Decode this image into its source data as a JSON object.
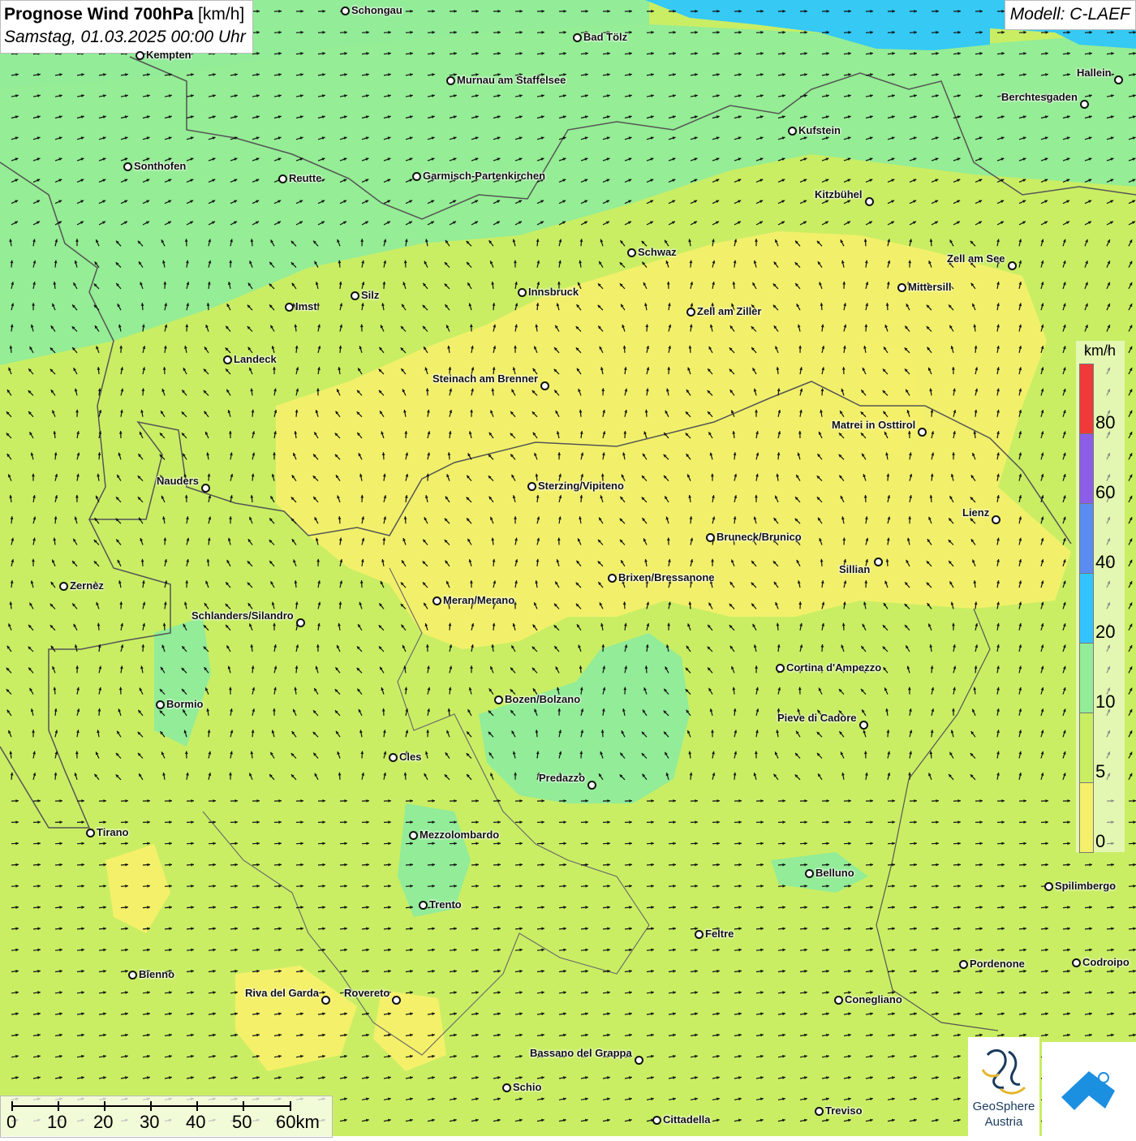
{
  "title": {
    "main": "Prognose Wind 700hPa",
    "unit": "[km/h]",
    "datetime": "Samstag, 01.03.2025 00:00 Uhr"
  },
  "model": "Modell: C-LAEF",
  "colors": {
    "speed_0_5": "#f5f06a",
    "speed_5_10": "#c9ee64",
    "speed_10_20": "#92ec98",
    "speed_20_40": "#33c4ff",
    "speed_40_60": "#5b8cf2",
    "speed_60_80": "#8c5ee8",
    "speed_80_plus": "#f03a3a",
    "border": "#555555"
  },
  "legend": {
    "unit": "km/h",
    "labels": [
      "80",
      "60",
      "40",
      "20",
      "10",
      "5",
      "0"
    ]
  },
  "scale_bar": {
    "labels": [
      "0",
      "10",
      "20",
      "30",
      "40",
      "50",
      "60km"
    ]
  },
  "logos": {
    "geosphere_line1": "GeoSphere",
    "geosphere_line2": "Austria"
  },
  "cities": [
    {
      "id": "schongau",
      "name": "Schongau"
    },
    {
      "id": "bad-toelz",
      "name": "Bad Tölz"
    },
    {
      "id": "kempten",
      "name": "Kempten"
    },
    {
      "id": "murnau",
      "name": "Murnau am Staffelsee"
    },
    {
      "id": "hallein",
      "name": "Hallein"
    },
    {
      "id": "berchtesgaden",
      "name": "Berchtesgaden"
    },
    {
      "id": "kufstein",
      "name": "Kufstein"
    },
    {
      "id": "sonthofen",
      "name": "Sonthofen"
    },
    {
      "id": "reutte",
      "name": "Reutte"
    },
    {
      "id": "garmisch",
      "name": "Garmisch-Partenkirchen"
    },
    {
      "id": "kitzbuehel",
      "name": "Kitzbühel"
    },
    {
      "id": "schwaz",
      "name": "Schwaz"
    },
    {
      "id": "zell-am-see",
      "name": "Zell am See"
    },
    {
      "id": "mittersill",
      "name": "Mittersill"
    },
    {
      "id": "imst",
      "name": "Imst"
    },
    {
      "id": "silz",
      "name": "Silz"
    },
    {
      "id": "innsbruck",
      "name": "Innsbruck"
    },
    {
      "id": "zell-am-ziller",
      "name": "Zell am Ziller"
    },
    {
      "id": "landeck",
      "name": "Landeck"
    },
    {
      "id": "steinach",
      "name": "Steinach am Brenner"
    },
    {
      "id": "matrei",
      "name": "Matrei in Osttirol"
    },
    {
      "id": "nauders",
      "name": "Nauders"
    },
    {
      "id": "sterzing",
      "name": "Sterzing/Vipiteno"
    },
    {
      "id": "lienz",
      "name": "Lienz"
    },
    {
      "id": "bruneck",
      "name": "Bruneck/Brunico"
    },
    {
      "id": "sillian",
      "name": "Sillian"
    },
    {
      "id": "zernez",
      "name": "Zernez"
    },
    {
      "id": "brixen",
      "name": "Brixen/Bressanone"
    },
    {
      "id": "meran",
      "name": "Meran/Merano"
    },
    {
      "id": "schlanders",
      "name": "Schlanders/Silandro"
    },
    {
      "id": "cortina",
      "name": "Cortina d'Ampezzo"
    },
    {
      "id": "bozen",
      "name": "Bozen/Bolzano"
    },
    {
      "id": "bormio",
      "name": "Bormio"
    },
    {
      "id": "pieve",
      "name": "Pieve di Cadore"
    },
    {
      "id": "cles",
      "name": "Cles"
    },
    {
      "id": "predazzo",
      "name": "Predazzo"
    },
    {
      "id": "tirano",
      "name": "Tirano"
    },
    {
      "id": "mezzolombardo",
      "name": "Mezzolombardo"
    },
    {
      "id": "belluno",
      "name": "Belluno"
    },
    {
      "id": "spilimbergo",
      "name": "Spilimbergo"
    },
    {
      "id": "trento",
      "name": "Trento"
    },
    {
      "id": "feltre",
      "name": "Feltre"
    },
    {
      "id": "pordenone",
      "name": "Pordenone"
    },
    {
      "id": "codroipo",
      "name": "Codroipo"
    },
    {
      "id": "bienno",
      "name": "Bienno"
    },
    {
      "id": "riva",
      "name": "Riva del Garda"
    },
    {
      "id": "rovereto",
      "name": "Rovereto"
    },
    {
      "id": "conegliano",
      "name": "Conegliano"
    },
    {
      "id": "bassano",
      "name": "Bassano del Grappa"
    },
    {
      "id": "schio",
      "name": "Schio"
    },
    {
      "id": "treviso",
      "name": "Treviso"
    },
    {
      "id": "cittadella",
      "name": "Cittadella"
    }
  ]
}
